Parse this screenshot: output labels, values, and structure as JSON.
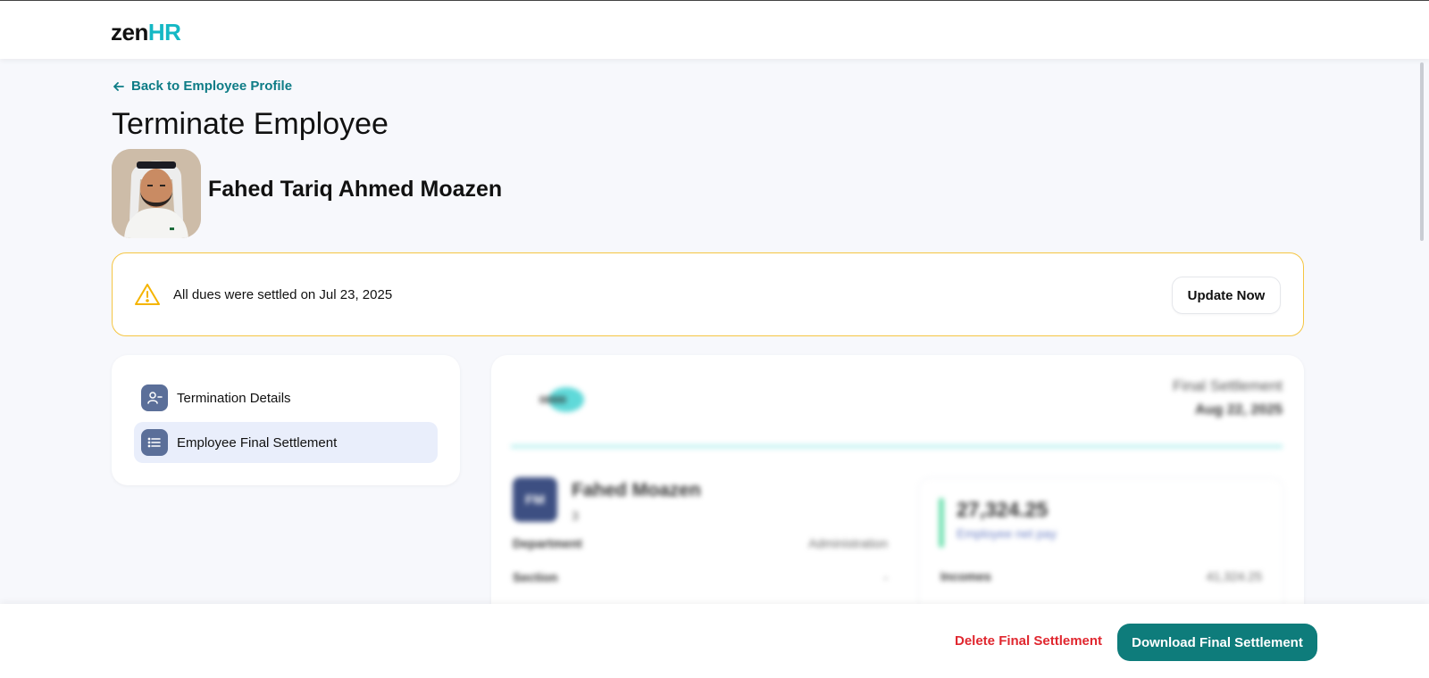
{
  "header": {
    "logo_part1": "zen",
    "logo_part2": "HR"
  },
  "nav": {
    "back_label": "Back to Employee Profile",
    "page_title": "Terminate Employee"
  },
  "employee": {
    "full_name": "Fahed Tariq Ahmed Moazen"
  },
  "alert": {
    "message": "All dues were settled on Jul 23, 2025",
    "action_label": "Update Now"
  },
  "sidebar": {
    "items": [
      {
        "label": "Termination Details",
        "icon": "user-minus-icon",
        "active": false
      },
      {
        "label": "Employee Final Settlement",
        "icon": "list-icon",
        "active": true
      }
    ]
  },
  "preview": {
    "doc_title": "Final Settlement",
    "doc_date": "Aug 22, 2025",
    "initials": "FM",
    "short_name": "Fahed Moazen",
    "employee_id": "3",
    "fields": [
      {
        "label": "Department",
        "value": "Administration"
      },
      {
        "label": "Section",
        "value": "-"
      }
    ],
    "net_pay_amount": "27,324.25",
    "net_pay_label": "Employee net pay",
    "incomes_label": "Incomes",
    "incomes_value": "41,324.25"
  },
  "footer": {
    "delete_label": "Delete Final Settlement",
    "download_label": "Download Final Settlement"
  },
  "colors": {
    "brand_teal": "#0e7c7b",
    "danger": "#e0272f",
    "warning": "#f5c542"
  }
}
